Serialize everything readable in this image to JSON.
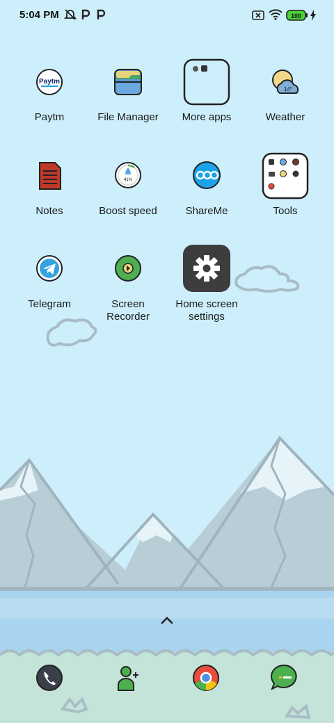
{
  "status_bar": {
    "time": "5:04 PM",
    "battery": "100",
    "icons": [
      "alarm-off-icon",
      "paytm-p-icon",
      "paytm-p-icon",
      "no-sim-icon",
      "wifi-icon",
      "battery-icon",
      "charging-icon"
    ]
  },
  "apps": [
    {
      "label": "Paytm",
      "icon": "paytm-icon"
    },
    {
      "label": "File Manager",
      "icon": "folder-icon"
    },
    {
      "label": "More apps",
      "icon": "more-apps-folder-icon"
    },
    {
      "label": "Weather",
      "icon": "weather-icon",
      "temp": "14°"
    },
    {
      "label": "Notes",
      "icon": "notes-icon"
    },
    {
      "label": "Boost speed",
      "icon": "boost-speed-icon",
      "percent": "41%"
    },
    {
      "label": "ShareMe",
      "icon": "shareme-icon"
    },
    {
      "label": "Tools",
      "icon": "tools-folder-icon"
    },
    {
      "label": "Telegram",
      "icon": "telegram-icon"
    },
    {
      "label": "Screen\nRecorder",
      "icon": "screen-recorder-icon"
    },
    {
      "label": "Home screen\nsettings",
      "icon": "gear-icon"
    }
  ],
  "paytm_logo_text": "Paytm",
  "dock": [
    "phone-icon",
    "contacts-icon",
    "chrome-icon",
    "messages-icon"
  ],
  "colors": {
    "sky": "#cdeefb",
    "mountain": "#b9cfd9",
    "water": "#a9d4ef",
    "ground": "#c4e4da",
    "accent_green": "#4caf50"
  }
}
